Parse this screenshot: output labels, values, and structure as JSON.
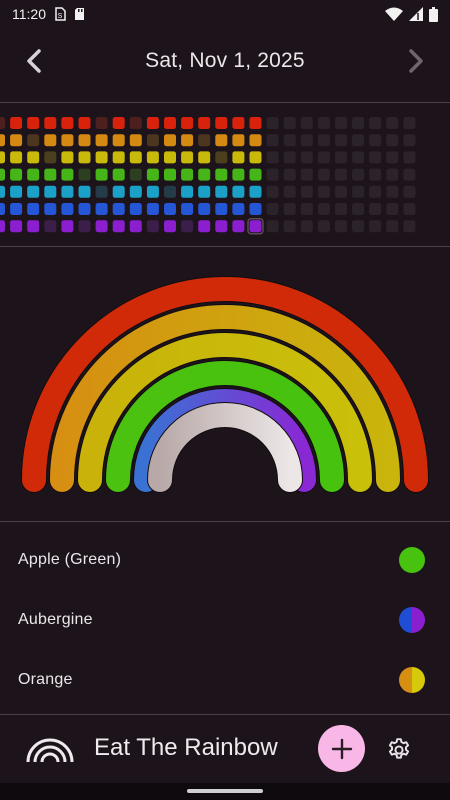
{
  "status_bar": {
    "time": "11:20",
    "left_icons": [
      "sim-manager-icon",
      "sd-card-icon"
    ],
    "right_icons": [
      "wifi-icon",
      "signal-icon",
      "battery-icon"
    ]
  },
  "header": {
    "date": "Sat, Nov 1, 2025",
    "prev_icon": "chevron-left-icon",
    "next_icon": "chevron-right-icon"
  },
  "history_grid": {
    "description_rows": [
      "red",
      "orange",
      "yellow",
      "green",
      "blue",
      "indigo",
      "violet"
    ],
    "row_colors": [
      "#d8220c",
      "#d48a12",
      "#c8b90a",
      "#45b517",
      "#1ba1c8",
      "#2456d6",
      "#8b1fcf"
    ],
    "columns": 25,
    "today_column": 15,
    "active_threshold": 15,
    "pattern": [
      [
        0,
        1,
        1,
        1,
        1,
        1,
        0,
        1,
        0,
        1,
        1,
        1,
        1,
        1,
        1,
        1,
        0,
        0,
        0,
        0,
        0,
        0,
        0,
        0,
        0
      ],
      [
        1,
        1,
        0,
        1,
        1,
        1,
        1,
        1,
        1,
        0,
        1,
        1,
        0,
        1,
        1,
        1,
        0,
        0,
        0,
        0,
        0,
        0,
        0,
        0,
        0
      ],
      [
        1,
        1,
        1,
        0,
        1,
        1,
        1,
        1,
        1,
        1,
        1,
        1,
        1,
        0,
        1,
        1,
        0,
        0,
        0,
        0,
        0,
        0,
        0,
        0,
        0
      ],
      [
        1,
        1,
        1,
        1,
        1,
        0,
        1,
        1,
        0,
        1,
        1,
        1,
        1,
        1,
        1,
        1,
        0,
        0,
        0,
        0,
        0,
        0,
        0,
        0,
        0
      ],
      [
        1,
        1,
        1,
        1,
        1,
        1,
        0,
        1,
        1,
        1,
        0,
        1,
        1,
        1,
        1,
        1,
        0,
        0,
        0,
        0,
        0,
        0,
        0,
        0,
        0
      ],
      [
        1,
        1,
        1,
        1,
        1,
        1,
        1,
        1,
        1,
        1,
        1,
        1,
        1,
        1,
        1,
        1,
        0,
        0,
        0,
        0,
        0,
        0,
        0,
        0,
        0
      ],
      [
        1,
        1,
        1,
        0,
        1,
        0,
        1,
        1,
        1,
        0,
        1,
        0,
        1,
        1,
        1,
        1,
        0,
        0,
        0,
        0,
        0,
        0,
        0,
        0,
        0
      ]
    ]
  },
  "rainbow": {
    "band_colors": [
      "#d12a08",
      "#d68f12",
      "#d6c90c",
      "#47c20f",
      "#3d6fd6",
      "#d8d0d0"
    ],
    "band_gradients": [
      [
        "#d12a08",
        "#d12a08"
      ],
      [
        "#d68f12",
        "#c9b50c"
      ],
      [
        "#c9b20a",
        "#c9c00a"
      ],
      [
        "#4bc20f",
        "#46c20f"
      ],
      [
        "#3a72d4",
        "#8a28d4"
      ],
      [
        "#b8a9a8",
        "#ece6e6"
      ]
    ],
    "filled_bands": 5
  },
  "food_list": [
    {
      "name": "Apple (Green)",
      "colors": [
        "#47c20f"
      ]
    },
    {
      "name": "Aubergine",
      "colors": [
        "#1f4dd6",
        "#8a1fd0"
      ]
    },
    {
      "name": "Orange",
      "colors": [
        "#d68f12",
        "#d6c90c"
      ]
    }
  ],
  "bottom_bar": {
    "app_title": "Eat The Rainbow",
    "logo_icon": "rainbow-logo-icon",
    "add_button_icon": "plus-icon",
    "settings_icon": "gear-icon",
    "fab_color": "#f8b7e6"
  }
}
